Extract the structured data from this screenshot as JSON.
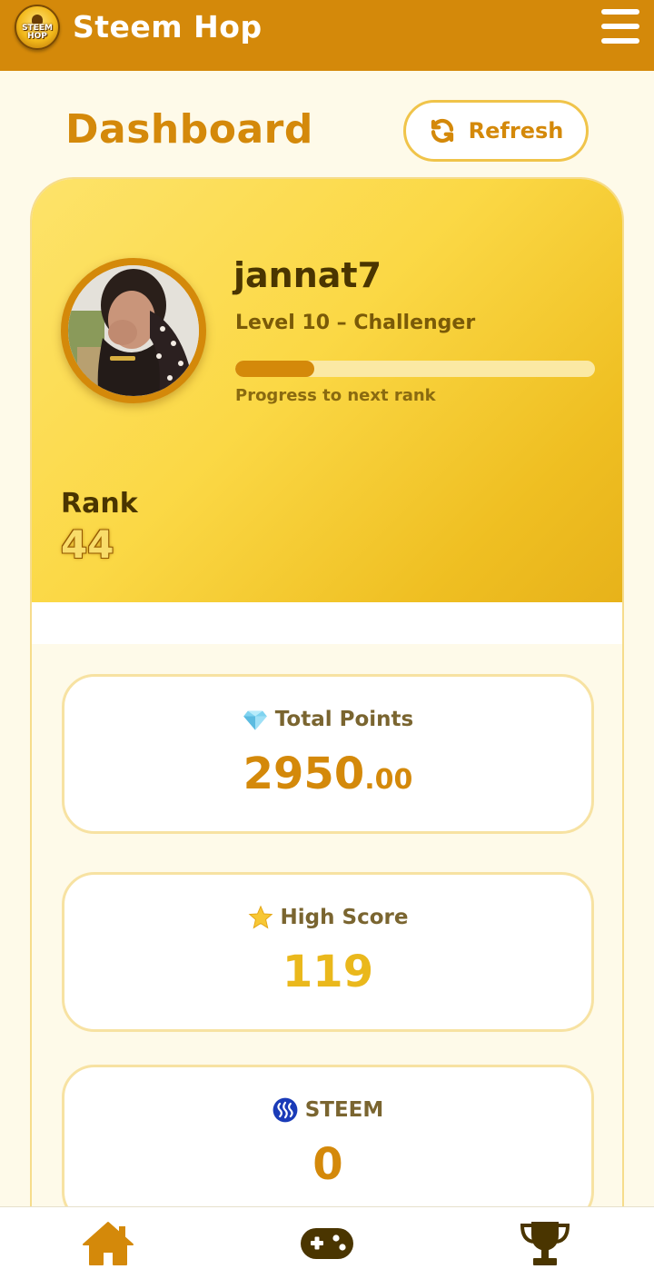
{
  "header": {
    "app_title": "Steem Hop",
    "logo_text_line1": "STEEM",
    "logo_text_line2": "HOP",
    "menu_icon": "hamburger-menu-icon"
  },
  "dashboard": {
    "title": "Dashboard",
    "refresh_label": "Refresh",
    "refresh_icon": "refresh-icon"
  },
  "profile": {
    "username": "jannat7",
    "level_text": "Level 10 – Challenger",
    "progress_fraction": 0.22,
    "progress_label": "Progress to next rank",
    "rank_label": "Rank",
    "rank_value": "44"
  },
  "stats": [
    {
      "icon": "gem-icon",
      "label": "Total Points",
      "value_int": "2950",
      "value_dec": ".00"
    },
    {
      "icon": "star-icon",
      "label": "High Score",
      "value": "119"
    },
    {
      "icon": "steem-icon",
      "label": "STEEM",
      "value": "0"
    }
  ],
  "bottom_nav": [
    {
      "icon": "home-icon",
      "active": true
    },
    {
      "icon": "gamepad-icon",
      "active": false
    },
    {
      "icon": "trophy-icon",
      "active": false
    }
  ],
  "colors": {
    "brand": "#d4890a",
    "hero_gradient_start": "#fde36a",
    "hero_gradient_end": "#e7b21a",
    "background": "#fefae9",
    "dark_text": "#4a3500"
  }
}
